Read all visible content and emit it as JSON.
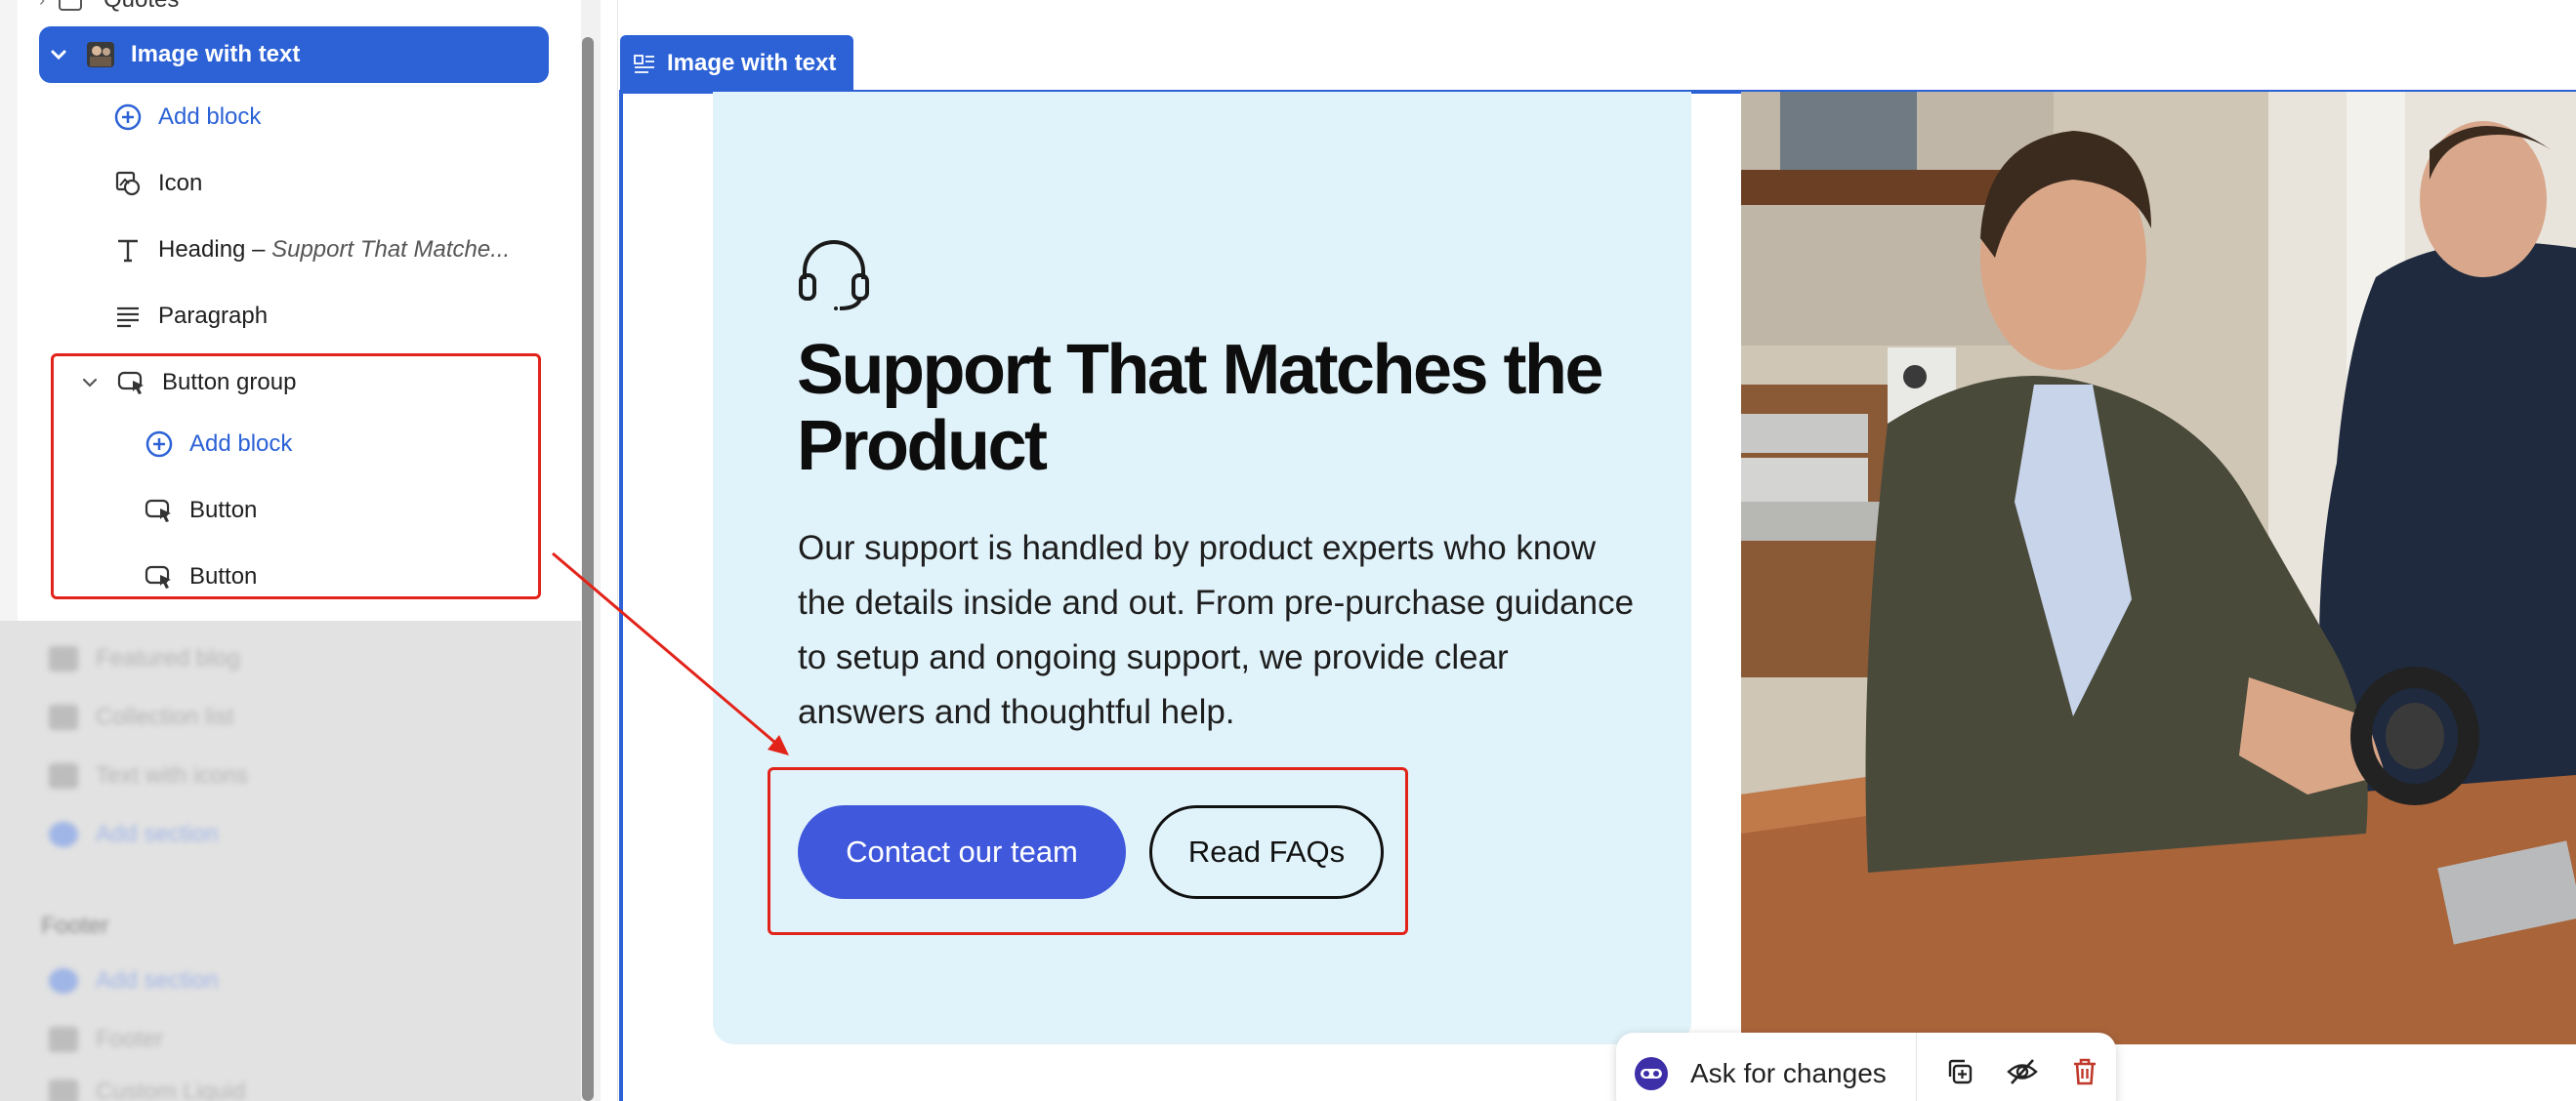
{
  "sidebar": {
    "partial_top_label": "Quotes",
    "selected_section": "Image with text",
    "items": [
      {
        "label": "Add block"
      },
      {
        "label": "Icon"
      },
      {
        "label": "Heading",
        "suffix": " – ",
        "sub": "Support That Matche..."
      },
      {
        "label": "Paragraph"
      },
      {
        "label": "Button group"
      },
      {
        "label": "Add block"
      },
      {
        "label": "Button"
      },
      {
        "label": "Button"
      }
    ],
    "blurred_items": [
      "Featured blog",
      "Collection list",
      "Text with icons",
      "Add section",
      "Footer",
      "Add section",
      "Footer",
      "Custom Liquid"
    ]
  },
  "preview": {
    "section_tag": "Image with text",
    "heading": "Support That Matches the Product",
    "paragraph": "Our support is handled by product experts who know the details inside and out. From pre-purchase guidance to setup and ongoing support, we provide clear answers and thoughtful help.",
    "primary_button": "Contact our team",
    "secondary_button": "Read FAQs"
  },
  "toolbar": {
    "ask_label": "Ask for changes",
    "duplicate_icon": "duplicate-icon",
    "hide_icon": "eye-off-icon",
    "delete_icon": "trash-icon"
  },
  "colors": {
    "accent": "#2c62d6",
    "card_bg": "#e1f3fa",
    "primary_button": "#3f58dc",
    "highlight": "#e2231a",
    "delete": "#c0392b"
  }
}
